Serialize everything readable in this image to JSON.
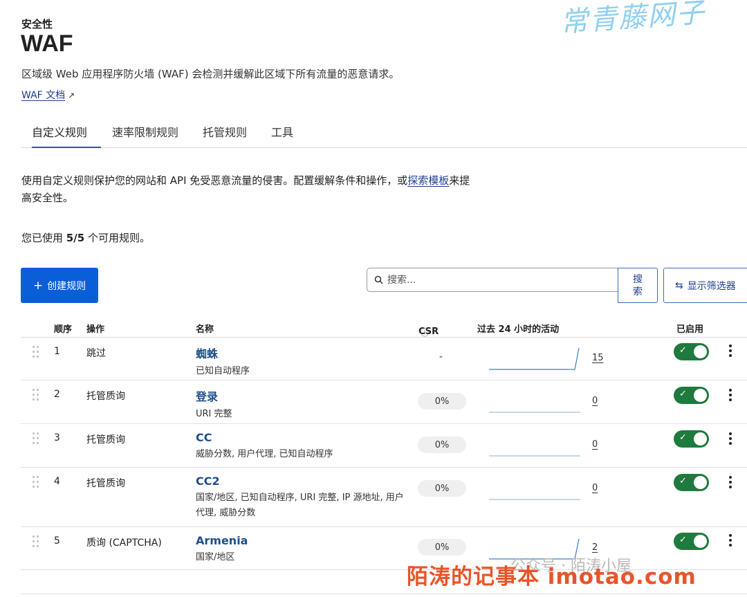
{
  "header": {
    "section": "安全性",
    "title": "WAF",
    "description": "区域级 Web 应用程序防火墙 (WAF) 会检测并缓解此区域下所有流量的恶意请求。",
    "doc_link": "WAF 文档"
  },
  "tabs": [
    {
      "label": "自定义规则",
      "active": true
    },
    {
      "label": "速率限制规则",
      "active": false
    },
    {
      "label": "托管规则",
      "active": false
    },
    {
      "label": "工具",
      "active": false
    }
  ],
  "intro": {
    "text": "使用自定义规则保护您的网站和 API 免受恶意流量的侵害。配置缓解条件和操作，或",
    "link": "探索模板",
    "suffix": "来提高安全性。"
  },
  "usage": {
    "prefix": "您已使用",
    "count": "5/5",
    "suffix": "个可用规则。"
  },
  "toolbar": {
    "create_label": "创建规则",
    "search_placeholder": "搜索...",
    "search_button": "搜索",
    "filter_button": "显示筛选器"
  },
  "table": {
    "columns": {
      "order": "顺序",
      "action": "操作",
      "name": "名称",
      "csr": "CSR",
      "activity": "过去 24 小时的活动",
      "enabled": "已启用"
    },
    "rows": [
      {
        "order": "1",
        "action": "跳过",
        "name": "蜘蛛",
        "subtitle": "已知自动程序",
        "csr": "-",
        "count": "15",
        "spike": true,
        "enabled": true
      },
      {
        "order": "2",
        "action": "托管质询",
        "name": "登录",
        "subtitle": "URI 完整",
        "csr": "0%",
        "count": "0",
        "spike": false,
        "enabled": true
      },
      {
        "order": "3",
        "action": "托管质询",
        "name": "CC",
        "subtitle": "威胁分数, 用户代理, 已知自动程序",
        "csr": "0%",
        "count": "0",
        "spike": false,
        "enabled": true
      },
      {
        "order": "4",
        "action": "托管质询",
        "name": "CC2",
        "subtitle": "国家/地区, 已知自动程序, URI 完整, IP 源地址, 用户代理, 威胁分数",
        "csr": "0%",
        "count": "0",
        "spike": false,
        "enabled": true
      },
      {
        "order": "5",
        "action": "质询 (CAPTCHA)",
        "name": "Armenia",
        "subtitle": "国家/地区",
        "csr": "0%",
        "count": "2",
        "spike": true,
        "enabled": true
      }
    ]
  },
  "watermarks": {
    "top": "常青藤网子",
    "bottom": "陌涛的记事本 imotao.com",
    "wechat": "公众号 · 陌涛小屋"
  },
  "colors": {
    "primary_button": "#0a5fd8",
    "link": "#1f3e8f",
    "rule_name": "#1f4f8c",
    "toggle_on": "#1e7a3d",
    "active_tab": "#1b5fb3"
  }
}
